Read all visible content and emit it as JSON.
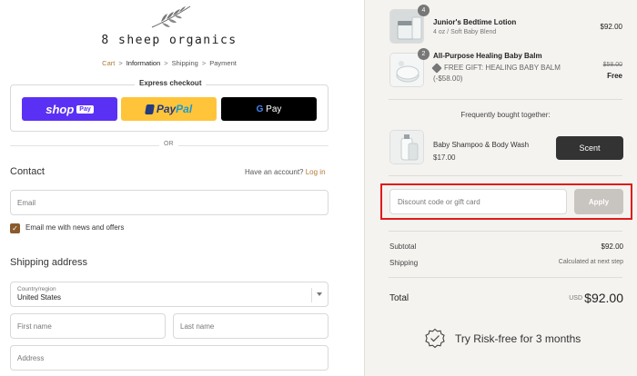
{
  "brand": {
    "name": "8 sheep organics"
  },
  "breadcrumb": {
    "cart": "Cart",
    "information": "Information",
    "shipping": "Shipping",
    "payment": "Payment",
    "separator": ">"
  },
  "express": {
    "title": "Express checkout",
    "shop_label": "shop",
    "shop_badge": "Pay",
    "paypal_a": "Pay",
    "paypal_b": "Pal",
    "gpay_g": "G",
    "gpay_label": " Pay"
  },
  "or_label": "OR",
  "contact": {
    "heading": "Contact",
    "account_prompt": "Have an account?",
    "login_link": "Log in",
    "email_placeholder": "Email",
    "newsletter_label": "Email me with news and offers",
    "newsletter_checked": true
  },
  "shipping": {
    "heading": "Shipping address",
    "country_label": "Country/region",
    "country_value": "United States",
    "first_name_placeholder": "First name",
    "last_name_placeholder": "Last name",
    "address_placeholder": "Address"
  },
  "cart": {
    "items": [
      {
        "name": "Junior's Bedtime Lotion",
        "variant": "4 oz / Soft Baby Blend",
        "qty": "4",
        "price": "$92.00"
      },
      {
        "name": "All-Purpose Healing Baby Balm",
        "variant": "FREE GIFT: HEALING BABY BALM",
        "variant2": "(-$58.00)",
        "qty": "2",
        "original_price": "$58.00",
        "price": "Free"
      }
    ],
    "upsell": {
      "heading": "Frequently bought together:",
      "name": "Baby Shampoo & Body Wash",
      "price": "$17.00",
      "button": "Scent"
    },
    "discount": {
      "placeholder": "Discount code or gift card",
      "apply": "Apply"
    },
    "summary": {
      "subtotal_label": "Subtotal",
      "subtotal": "$92.00",
      "shipping_label": "Shipping",
      "shipping": "Calculated at next step",
      "total_label": "Total",
      "currency": "USD",
      "total": "$92.00"
    },
    "risk_free": "Try Risk-free for 3 months"
  },
  "colors": {
    "accent": "#b07a3a",
    "shop_pay": "#5a31f4",
    "paypal": "#ffc439",
    "highlight": "#e01b1b"
  }
}
